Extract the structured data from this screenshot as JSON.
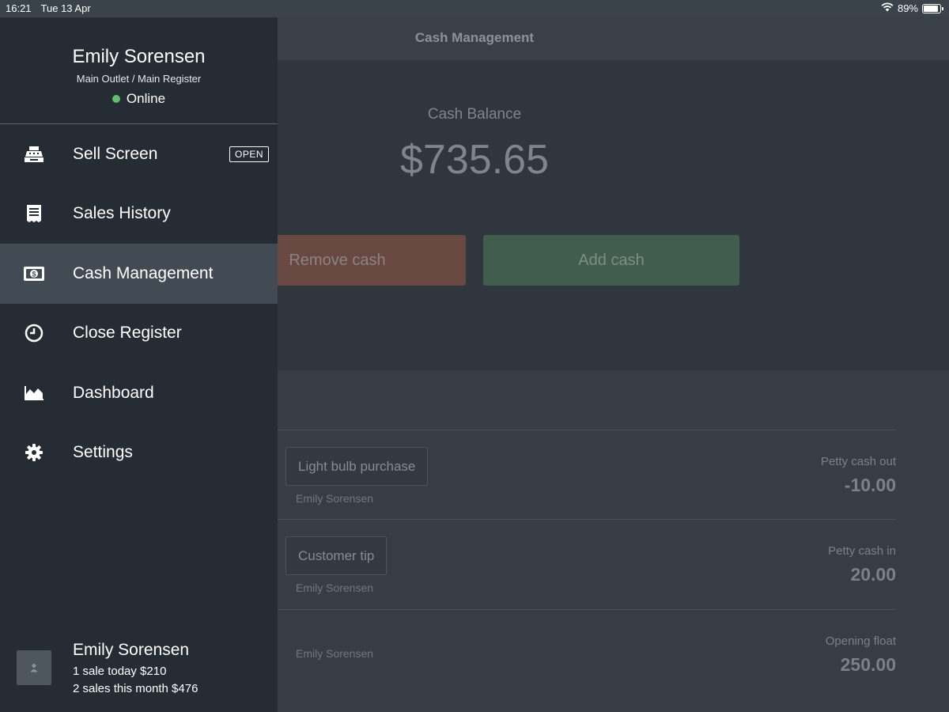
{
  "status_bar": {
    "time": "16:21",
    "date": "Tue 13 Apr",
    "battery": "89%",
    "battery_level": 0.89,
    "icons": [
      "wifi-icon",
      "battery-icon"
    ]
  },
  "header": {
    "title": "Cash Management"
  },
  "balance": {
    "label": "Cash Balance",
    "value": "$735.65"
  },
  "buttons": {
    "remove": "Remove cash",
    "add": "Add cash"
  },
  "transactions": [
    {
      "note": "Light bulb purchase",
      "user": "Emily Sorensen",
      "type": "Petty cash out",
      "amount": "-10.00"
    },
    {
      "note": "Customer tip",
      "user": "Emily Sorensen",
      "type": "Petty cash in",
      "amount": "20.00"
    },
    {
      "note": "",
      "user": "Emily Sorensen",
      "type": "Opening float",
      "amount": "250.00"
    }
  ],
  "sidebar": {
    "profile": {
      "name": "Emily Sorensen",
      "outlet": "Main Outlet / Main Register",
      "status": "Online"
    },
    "items": [
      {
        "label": "Sell Screen",
        "icon": "register-icon",
        "badge": "OPEN"
      },
      {
        "label": "Sales History",
        "icon": "receipt-icon"
      },
      {
        "label": "Cash Management",
        "icon": "cash-icon",
        "active": true
      },
      {
        "label": "Close Register",
        "icon": "clock-icon"
      },
      {
        "label": "Dashboard",
        "icon": "chart-icon"
      },
      {
        "label": "Settings",
        "icon": "gear-icon"
      }
    ],
    "footer": {
      "name": "Emily Sorensen",
      "today": "1 sale today $210",
      "month": "2 sales this month $476"
    }
  },
  "colors": {
    "sidebar_bg": "#262c33",
    "active_item_bg": "#424b54",
    "online_dot": "#5fbf6f",
    "remove_button": "#6a4842",
    "add_button": "#405e4b"
  }
}
